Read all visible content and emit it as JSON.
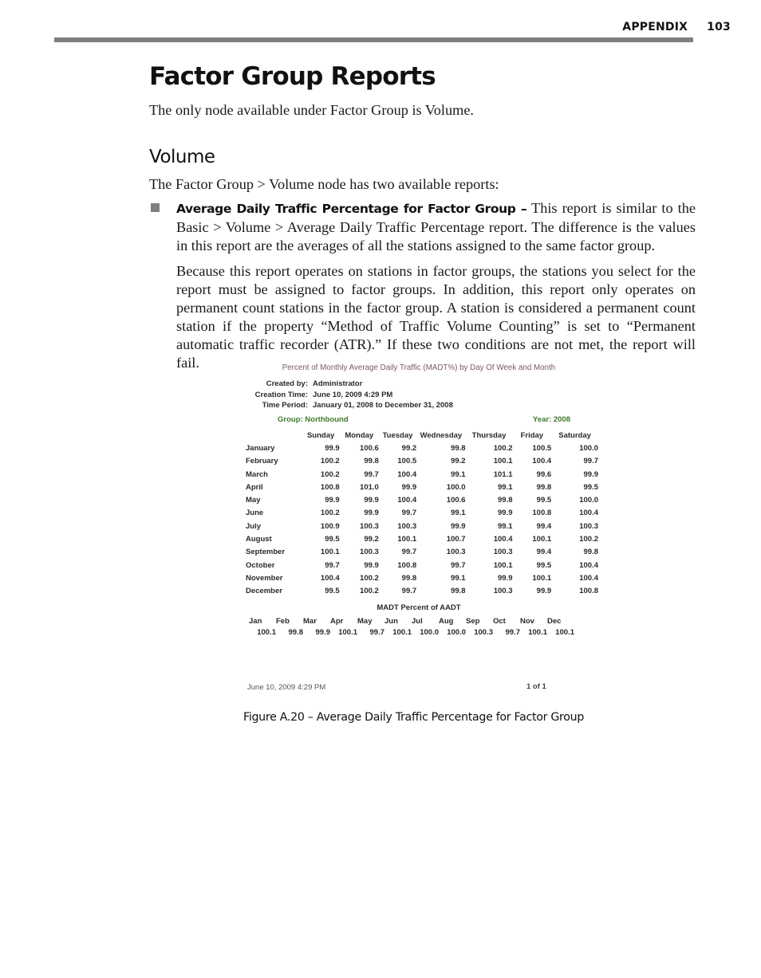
{
  "running_head": {
    "section": "APPENDIX",
    "page_number": "103"
  },
  "title": "Factor Group Reports",
  "intro": "The only node available under Factor Group is Volume.",
  "subsection": {
    "heading": "Volume",
    "intro": "The Factor Group > Volume node has two available reports:",
    "bullet": {
      "term": "Average Daily Traffic Percentage for Factor Group –",
      "text": " This report is similar to the Basic > Volume > Average Daily Traffic Percentage report. The difference is the values in this report are the averages of all the stations assigned to the same factor group."
    },
    "paragraph": "Because this report operates on stations in factor groups, the stations you select for the report must be assigned to factor groups. In addition, this report only operates on permanent count stations in the factor group. A station is considered a permanent count station if the property “Method of Traffic Volume Counting” is set to “Permanent automatic traffic recorder (ATR).” If these two conditions are not met, the report will fail."
  },
  "figure": {
    "report_title": "Percent of Monthly Average Daily Traffic (MADT%) by Day Of Week and Month",
    "meta": [
      {
        "label": "Created by:",
        "value": "Administrator"
      },
      {
        "label": "Creation Time:",
        "value": "June 10, 2009 4:29 PM"
      },
      {
        "label": "Time Period:",
        "value": "January 01, 2008 to December 31, 2008"
      }
    ],
    "group": "Group: Northbound",
    "year": "Year: 2008",
    "accent_color": "#3f7a2c",
    "columns": [
      "",
      "Sunday",
      "Monday",
      "Tuesday",
      "Wednesday",
      "Thursday",
      "Friday",
      "Saturday"
    ],
    "rows": [
      [
        "January",
        "99.9",
        "100.6",
        "99.2",
        "99.8",
        "100.2",
        "100.5",
        "100.0"
      ],
      [
        "February",
        "100.2",
        "99.8",
        "100.5",
        "99.2",
        "100.1",
        "100.4",
        "99.7"
      ],
      [
        "March",
        "100.2",
        "99.7",
        "100.4",
        "99.1",
        "101.1",
        "99.6",
        "99.9"
      ],
      [
        "April",
        "100.8",
        "101.0",
        "99.9",
        "100.0",
        "99.1",
        "99.8",
        "99.5"
      ],
      [
        "May",
        "99.9",
        "99.9",
        "100.4",
        "100.6",
        "99.8",
        "99.5",
        "100.0"
      ],
      [
        "June",
        "100.2",
        "99.9",
        "99.7",
        "99.1",
        "99.9",
        "100.8",
        "100.4"
      ],
      [
        "July",
        "100.9",
        "100.3",
        "100.3",
        "99.9",
        "99.1",
        "99.4",
        "100.3"
      ],
      [
        "August",
        "99.5",
        "99.2",
        "100.1",
        "100.7",
        "100.4",
        "100.1",
        "100.2"
      ],
      [
        "September",
        "100.1",
        "100.3",
        "99.7",
        "100.3",
        "100.3",
        "99.4",
        "99.8"
      ],
      [
        "October",
        "99.7",
        "99.9",
        "100.8",
        "99.7",
        "100.1",
        "99.5",
        "100.4"
      ],
      [
        "November",
        "100.4",
        "100.2",
        "99.8",
        "99.1",
        "99.9",
        "100.1",
        "100.4"
      ],
      [
        "December",
        "99.5",
        "100.2",
        "99.7",
        "99.8",
        "100.3",
        "99.9",
        "100.8"
      ]
    ],
    "aadt_title": "MADT Percent of AADT",
    "aadt_months": [
      "Jan",
      "Feb",
      "Mar",
      "Apr",
      "May",
      "Jun",
      "Jul",
      "Aug",
      "Sep",
      "Oct",
      "Nov",
      "Dec"
    ],
    "aadt_values": [
      "100.1",
      "99.8",
      "99.9",
      "100.1",
      "99.7",
      "100.1",
      "100.0",
      "100.0",
      "100.3",
      "99.7",
      "100.1",
      "100.1"
    ],
    "footer_date": "June 10, 2009 4:29 PM",
    "footer_page": "1  of 1",
    "caption": "Figure A.20 – Average Daily Traffic Percentage for Factor Group"
  }
}
